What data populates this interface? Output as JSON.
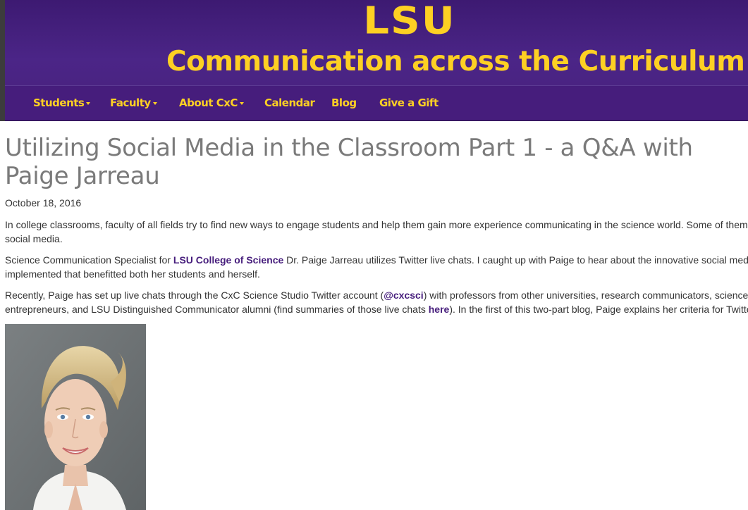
{
  "header": {
    "logo_text": "LSU",
    "site_title": "Communication across the Curriculum"
  },
  "nav": {
    "items": [
      {
        "label": "Students",
        "dropdown": true
      },
      {
        "label": "Faculty",
        "dropdown": true
      },
      {
        "label": "About CxC",
        "dropdown": true
      },
      {
        "label": "Calendar",
        "dropdown": false
      },
      {
        "label": "Blog",
        "dropdown": false
      },
      {
        "label": "Give a Gift",
        "dropdown": false
      }
    ]
  },
  "post": {
    "title": "Utilizing Social Media in the Classroom Part 1 - a Q&A with Paige Jarreau",
    "date": "October 18, 2016",
    "p1": {
      "line1": "In college classrooms, faculty of all fields try to find new ways to engage students and help them gain more experience communicating in the science world. Some of them",
      "line2": "social media."
    },
    "p2": {
      "pre": "Science Communication Specialist for ",
      "link": "LSU College of Science",
      "post": " Dr. Paige Jarreau utilizes Twitter live chats. I caught up with Paige to hear about the innovative social media",
      "line2": "implemented that benefitted both her students and herself."
    },
    "p3": {
      "pre": "Recently, Paige has set up live chats through the CxC Science Studio Twitter account (",
      "link": "@cxcsci",
      "post": ") with professors from other universities, research communicators, science",
      "line2_pre": "entrepreneurs, and LSU Distinguished Communicator alumni (find summaries of those live chats ",
      "line2_link": "here",
      "line2_post": "). In the first of this two-part blog, Paige explains her criteria for Twitte"
    }
  },
  "colors": {
    "brand_purple": "#461d7c",
    "brand_gold": "#fdd023",
    "title_gray": "#7a7a7a"
  }
}
